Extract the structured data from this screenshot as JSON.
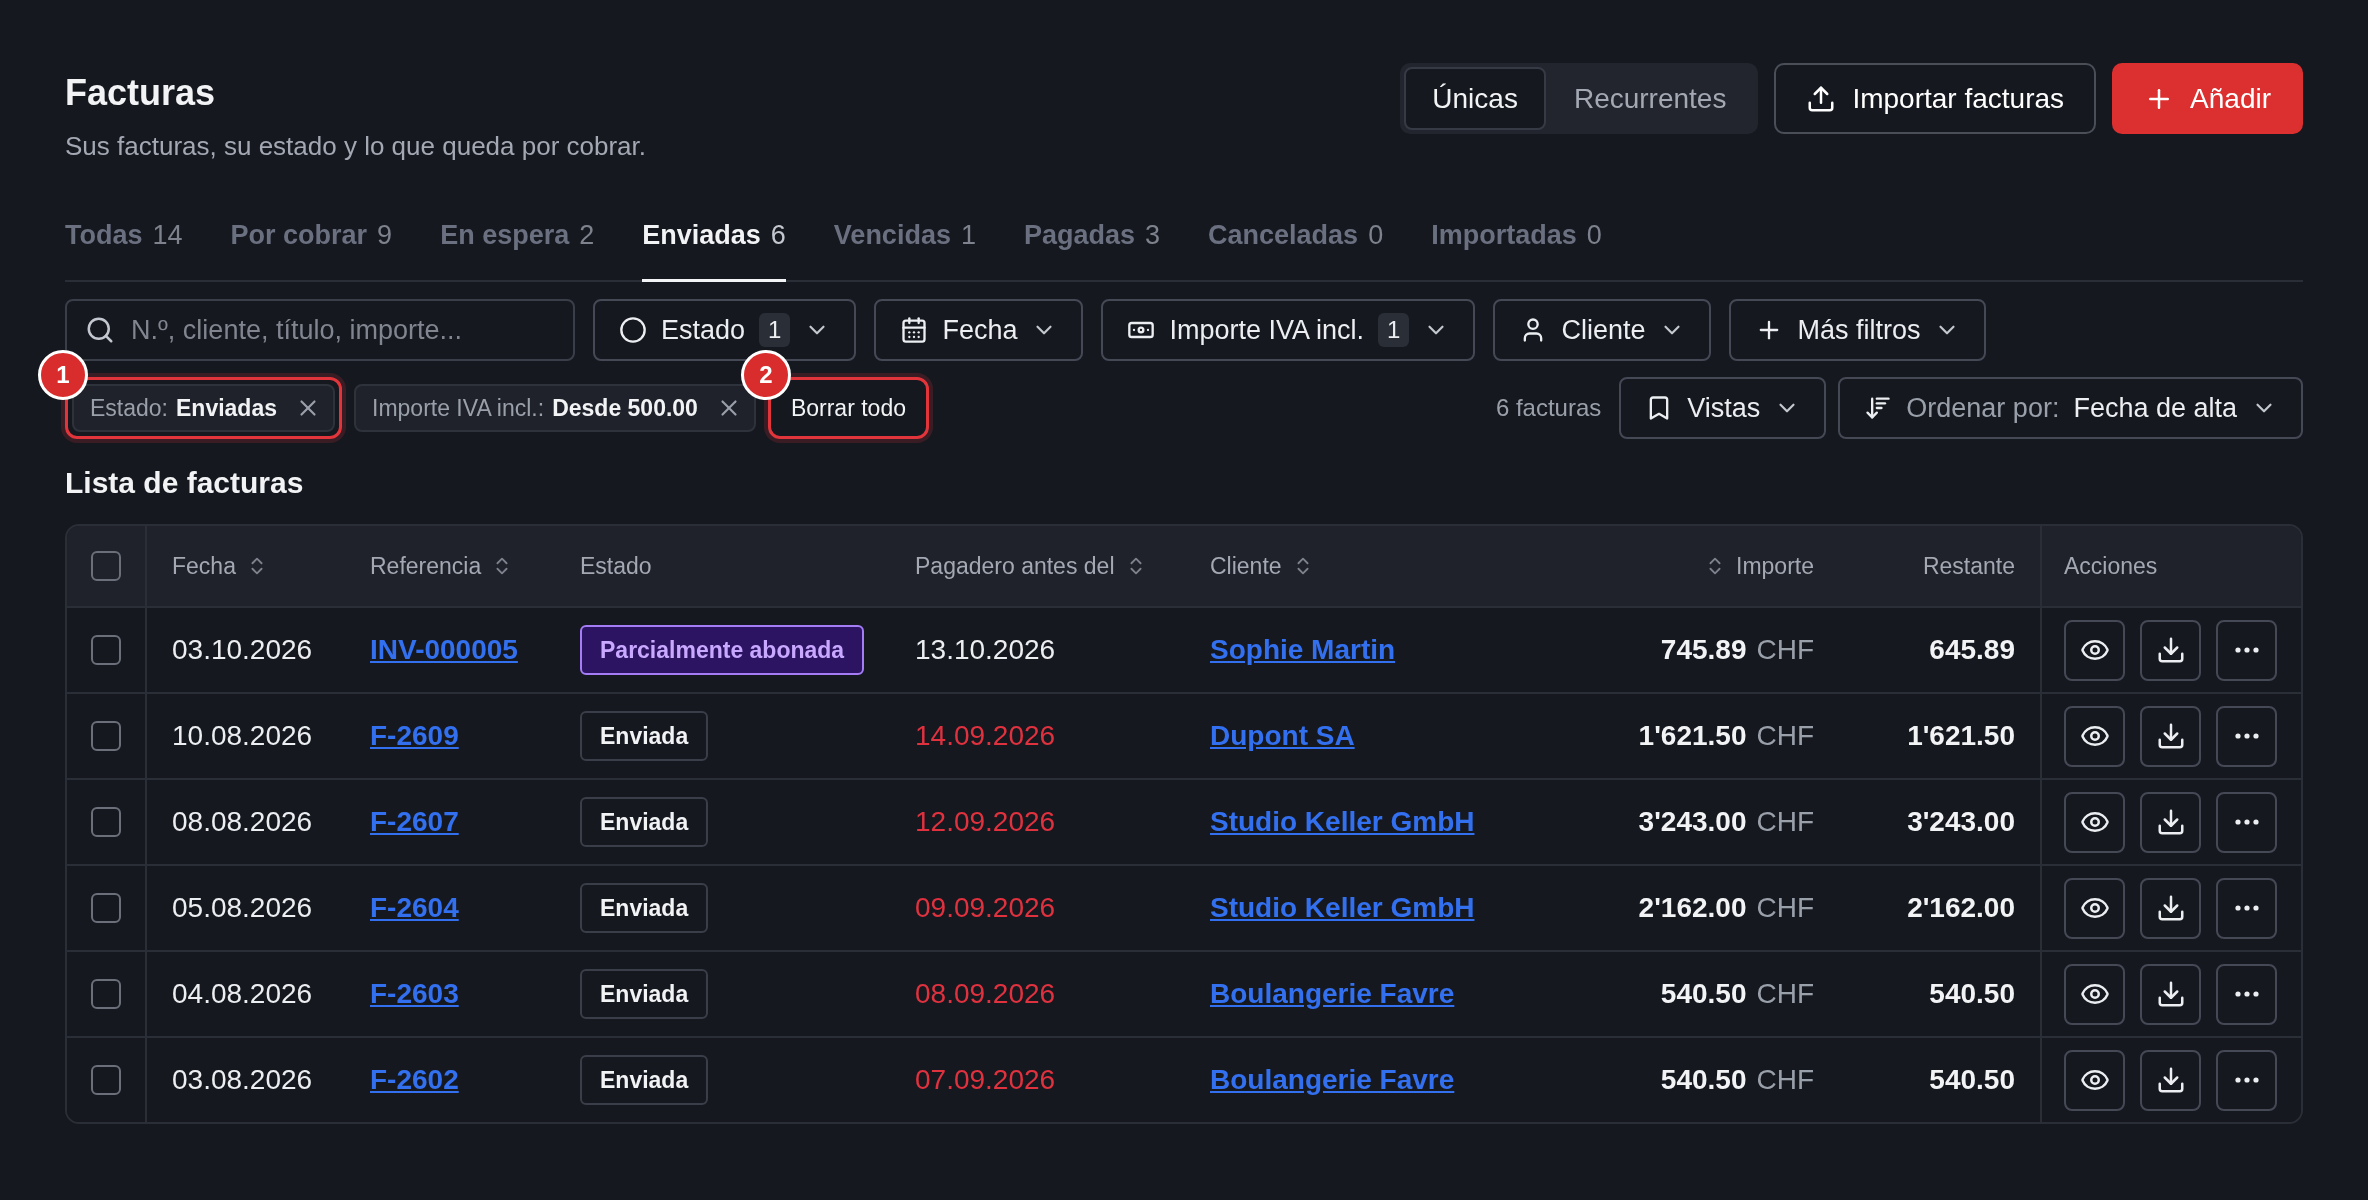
{
  "header": {
    "title": "Facturas",
    "subtitle": "Sus facturas, su estado y lo que queda por cobrar."
  },
  "view_toggle": [
    {
      "label": "Únicas",
      "selected": true
    },
    {
      "label": "Recurrentes",
      "selected": false
    }
  ],
  "header_actions": [
    {
      "kind": "import",
      "label": "Importar facturas"
    },
    {
      "kind": "add",
      "label": "Añadir"
    }
  ],
  "tabs": [
    {
      "label": "Todas",
      "count": "14",
      "selected": false
    },
    {
      "label": "Por cobrar",
      "count": "9",
      "selected": false
    },
    {
      "label": "En espera",
      "count": "2",
      "selected": false
    },
    {
      "label": "Enviadas",
      "count": "6",
      "selected": true
    },
    {
      "label": "Vencidas",
      "count": "1",
      "selected": false
    },
    {
      "label": "Pagadas",
      "count": "3",
      "selected": false
    },
    {
      "label": "Canceladas",
      "count": "0",
      "selected": false
    },
    {
      "label": "Importadas",
      "count": "0",
      "selected": false
    }
  ],
  "search": {
    "placeholder": "N.º, cliente, título, importe..."
  },
  "filters": [
    {
      "kind": "status",
      "label": "Estado",
      "count": "1"
    },
    {
      "kind": "date",
      "label": "Fecha"
    },
    {
      "kind": "amount",
      "label": "Importe IVA incl.",
      "count": "1"
    },
    {
      "kind": "client",
      "label": "Cliente"
    },
    {
      "kind": "more",
      "label": "Más filtros"
    }
  ],
  "active_filters": [
    {
      "label": "Estado:",
      "value": "Enviadas",
      "marker": "1"
    },
    {
      "label": "Importe IVA incl.:",
      "value": "Desde 500.00"
    }
  ],
  "clear_all": {
    "label": "Borrar todo",
    "marker": "2"
  },
  "result_count": "6 facturas",
  "views": {
    "label": "Vistas"
  },
  "sort": {
    "label": "Ordenar por:",
    "value": "Fecha de alta"
  },
  "table": {
    "title": "Lista de facturas",
    "select_all": {
      "checked": false
    },
    "columns": [
      {
        "kind": "text",
        "label": "Fecha",
        "sortable": true
      },
      {
        "kind": "text",
        "label": "Referencia",
        "sortable": true
      },
      {
        "kind": "text",
        "label": "Estado",
        "sortable": false
      },
      {
        "kind": "text",
        "label": "Pagadero antes del",
        "sortable": true
      },
      {
        "kind": "text",
        "label": "Cliente",
        "sortable": true
      },
      {
        "kind": "amount",
        "label": "Importe",
        "sortable": true
      },
      {
        "kind": "amount",
        "label": "Restante",
        "sortable": false
      },
      {
        "kind": "actions",
        "label": "Acciones",
        "sortable": false
      }
    ],
    "rows": [
      {
        "selected": false,
        "date": "03.10.2026",
        "reference": "INV-000005",
        "status": {
          "kind": "partial",
          "label": "Parcialmente abonada"
        },
        "due": "13.10.2026",
        "overdue": false,
        "client": "Sophie Martin",
        "amount": "745.89",
        "currency": "CHF",
        "remaining": "645.89"
      },
      {
        "selected": false,
        "date": "10.08.2026",
        "reference": "F-2609",
        "status": {
          "kind": "sent",
          "label": "Enviada"
        },
        "due": "14.09.2026",
        "overdue": true,
        "client": "Dupont SA",
        "amount": "1'621.50",
        "currency": "CHF",
        "remaining": "1'621.50"
      },
      {
        "selected": false,
        "date": "08.08.2026",
        "reference": "F-2607",
        "status": {
          "kind": "sent",
          "label": "Enviada"
        },
        "due": "12.09.2026",
        "overdue": true,
        "client": "Studio Keller GmbH",
        "amount": "3'243.00",
        "currency": "CHF",
        "remaining": "3'243.00"
      },
      {
        "selected": false,
        "date": "05.08.2026",
        "reference": "F-2604",
        "status": {
          "kind": "sent",
          "label": "Enviada"
        },
        "due": "09.09.2026",
        "overdue": true,
        "client": "Studio Keller GmbH",
        "amount": "2'162.00",
        "currency": "CHF",
        "remaining": "2'162.00"
      },
      {
        "selected": false,
        "date": "04.08.2026",
        "reference": "F-2603",
        "status": {
          "kind": "sent",
          "label": "Enviada"
        },
        "due": "08.09.2026",
        "overdue": true,
        "client": "Boulangerie Favre",
        "amount": "540.50",
        "currency": "CHF",
        "remaining": "540.50"
      },
      {
        "selected": false,
        "date": "03.08.2026",
        "reference": "F-2602",
        "status": {
          "kind": "sent",
          "label": "Enviada"
        },
        "due": "07.09.2026",
        "overdue": true,
        "client": "Boulangerie Favre",
        "amount": "540.50",
        "currency": "CHF",
        "remaining": "540.50"
      }
    ]
  }
}
